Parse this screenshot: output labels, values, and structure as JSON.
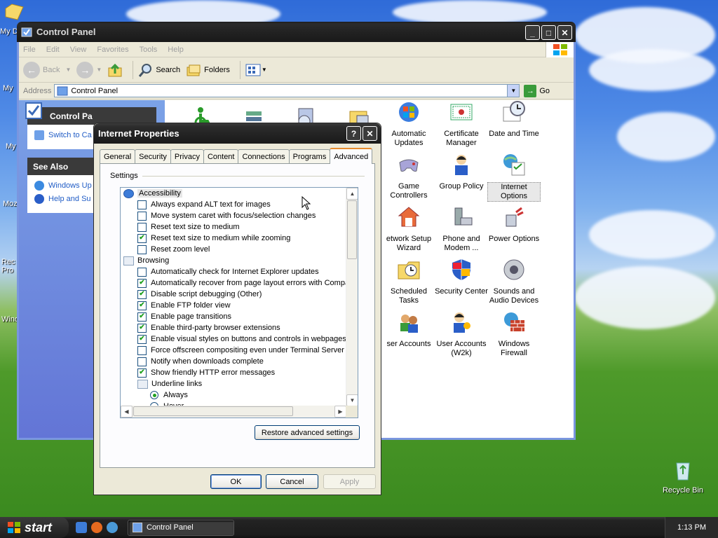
{
  "colors": {
    "accent_checked": "#21a121",
    "desktop_sky": "#2f6bd8",
    "desktop_grass": "#3b8a1f",
    "link": "#215dc6"
  },
  "desktop": {
    "icons": [
      {
        "id": "my-documents",
        "label": "My D"
      },
      {
        "id": "my-computer",
        "label": "My"
      },
      {
        "id": "my-network",
        "label": "My"
      },
      {
        "id": "mozilla",
        "label": "Moz"
      },
      {
        "id": "recycle-partial",
        "label": "Rec Pro"
      },
      {
        "id": "windows-partial",
        "label": "Wind"
      },
      {
        "id": "recycle-bin",
        "label": "Recycle Bin"
      }
    ]
  },
  "control_panel": {
    "title": "Control Panel",
    "menu": [
      "File",
      "Edit",
      "View",
      "Favorites",
      "Tools",
      "Help"
    ],
    "toolbar": {
      "back": "Back",
      "search": "Search",
      "folders": "Folders"
    },
    "address": {
      "label": "Address",
      "value": "Control Panel",
      "go": "Go"
    },
    "left_pane": {
      "control_panel_header": "Control Pa",
      "switch_link": "Switch to Ca",
      "see_also_header": "See Also",
      "see_also": [
        "Windows Up",
        "Help and Su"
      ]
    },
    "items": [
      {
        "label": "Automatic Updates",
        "icon": "automatic-updates-icon"
      },
      {
        "label": "Certificate Manager",
        "icon": "certificate-icon"
      },
      {
        "label": "Date and Time",
        "icon": "clock-icon"
      },
      {
        "label": "Game Controllers",
        "icon": "gamepad-icon"
      },
      {
        "label": "Group Policy",
        "icon": "group-policy-icon"
      },
      {
        "label": "Internet Options",
        "icon": "internet-options-icon"
      },
      {
        "label": "etwork Setup Wizard",
        "icon": "network-setup-icon"
      },
      {
        "label": "Phone and Modem ...",
        "icon": "phone-modem-icon"
      },
      {
        "label": "Power Options",
        "icon": "power-icon"
      },
      {
        "label": "Scheduled Tasks",
        "icon": "scheduled-tasks-icon"
      },
      {
        "label": "Security Center",
        "icon": "shield-icon"
      },
      {
        "label": "Sounds and Audio Devices",
        "icon": "speaker-icon"
      },
      {
        "label": "ser Accounts",
        "icon": "user-accounts-icon"
      },
      {
        "label": "User Accounts (W2k)",
        "icon": "user-accounts-w2k-icon"
      },
      {
        "label": "Windows Firewall",
        "icon": "firewall-icon"
      }
    ]
  },
  "dialog": {
    "title": "Internet Properties",
    "tabs": [
      "General",
      "Security",
      "Privacy",
      "Content",
      "Connections",
      "Programs",
      "Advanced"
    ],
    "active_tab": "Advanced",
    "settings_label": "Settings",
    "rows": [
      {
        "kind": "cat",
        "icon": "accessibility-icon",
        "label": "Accessibility",
        "highlight": true
      },
      {
        "kind": "check",
        "checked": false,
        "label": "Always expand ALT text for images"
      },
      {
        "kind": "check",
        "checked": false,
        "label": "Move system caret with focus/selection changes"
      },
      {
        "kind": "check",
        "checked": false,
        "label": "Reset text size to medium"
      },
      {
        "kind": "check",
        "checked": true,
        "label": "Reset text size to medium while zooming"
      },
      {
        "kind": "check",
        "checked": false,
        "label": "Reset zoom level"
      },
      {
        "kind": "cat",
        "icon": "browsing-icon",
        "label": "Browsing"
      },
      {
        "kind": "check",
        "checked": false,
        "label": "Automatically check for Internet Explorer updates"
      },
      {
        "kind": "check",
        "checked": true,
        "label": "Automatically recover from page layout errors with Compa"
      },
      {
        "kind": "check",
        "checked": true,
        "label": "Disable script debugging (Other)"
      },
      {
        "kind": "check",
        "checked": true,
        "label": "Enable FTP folder view"
      },
      {
        "kind": "check",
        "checked": true,
        "label": "Enable page transitions"
      },
      {
        "kind": "check",
        "checked": true,
        "label": "Enable third-party browser extensions"
      },
      {
        "kind": "check",
        "checked": true,
        "label": "Enable visual styles on buttons and controls in webpages"
      },
      {
        "kind": "check",
        "checked": false,
        "label": "Force offscreen compositing even under Terminal Server"
      },
      {
        "kind": "check",
        "checked": false,
        "label": "Notify when downloads complete"
      },
      {
        "kind": "check",
        "checked": true,
        "label": "Show friendly HTTP error messages"
      },
      {
        "kind": "subcat",
        "icon": "underline-links-icon",
        "label": "Underline links"
      },
      {
        "kind": "radio",
        "checked": true,
        "label": "Always"
      },
      {
        "kind": "radio",
        "checked": false,
        "label": "Hover"
      }
    ],
    "restore_button": "Restore advanced settings",
    "ok": "OK",
    "cancel": "Cancel",
    "apply": "Apply"
  },
  "taskbar": {
    "start": "start",
    "task": "Control Panel",
    "clock": "1:13 PM"
  }
}
